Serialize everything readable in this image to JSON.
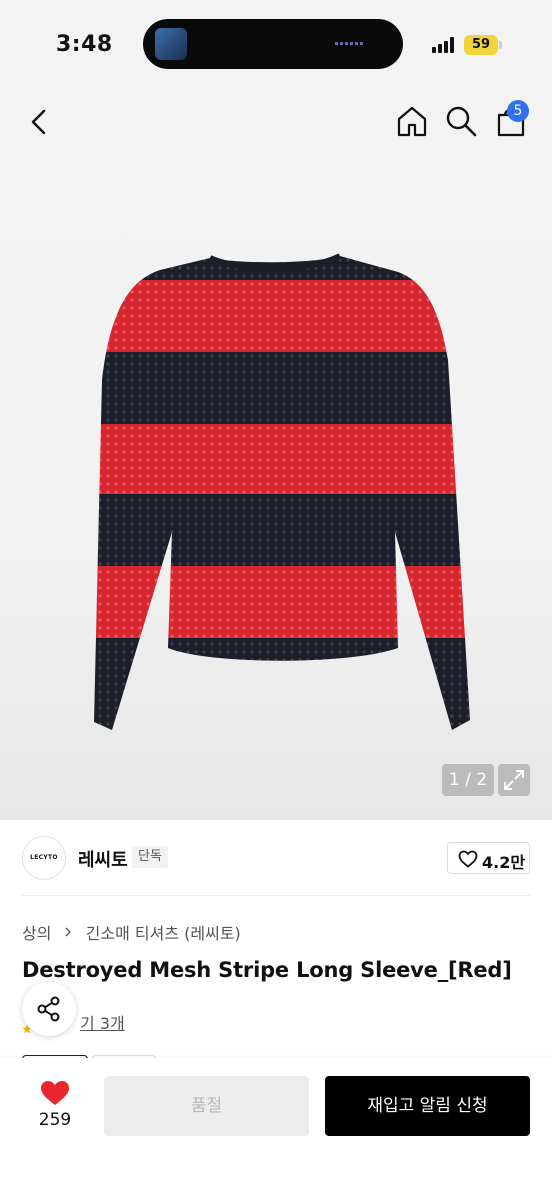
{
  "status_bar": {
    "time": "3:48",
    "battery": "59"
  },
  "header": {
    "cart_count": "5",
    "icons": [
      "back-icon",
      "home-icon",
      "search-icon",
      "shopping-bag-icon"
    ]
  },
  "gallery": {
    "counter": "1 / 2",
    "current_image": 1,
    "total_images": 2,
    "stripe_colors": [
      "#d92a33",
      "#1c1f2a"
    ]
  },
  "brand": {
    "logo_text": "LECYTO",
    "name": "레씨토",
    "tag": "단독",
    "like_count": "4.2만"
  },
  "product": {
    "breadcrumb": [
      "상의",
      "긴소매 티셔츠 (레씨토)"
    ],
    "title": "Destroyed Mesh Stripe Long Sleeve_[Red]",
    "review_link": "기 3개"
  },
  "bottom_bar": {
    "heart_count": "259",
    "soldout_label": "품절",
    "restock_label": "재입고 알림 신청",
    "heart_color": "#e8262c"
  }
}
